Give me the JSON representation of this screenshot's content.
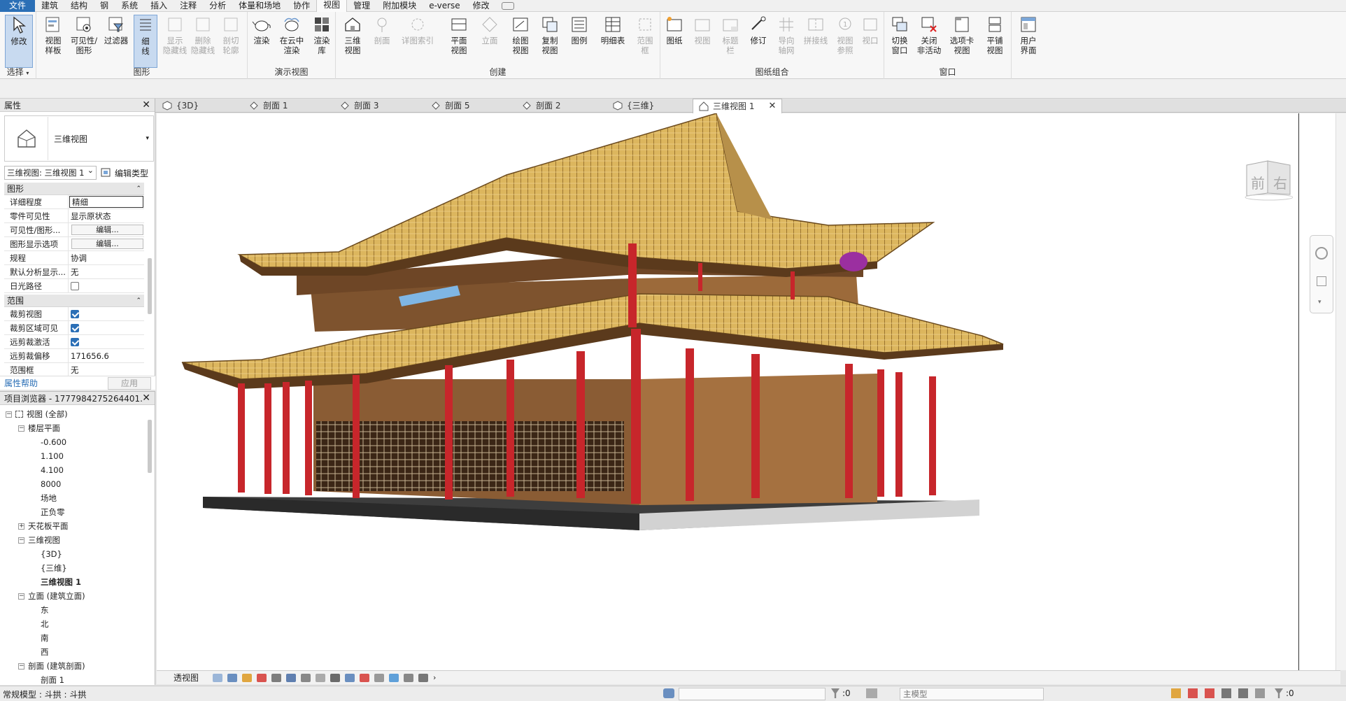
{
  "menu": {
    "tabs": [
      {
        "label": "文件",
        "name": "menu-tab-file"
      },
      {
        "label": "建筑",
        "name": "menu-tab-architecture"
      },
      {
        "label": "结构",
        "name": "menu-tab-structure"
      },
      {
        "label": "钢",
        "name": "menu-tab-steel"
      },
      {
        "label": "系统",
        "name": "menu-tab-systems"
      },
      {
        "label": "插入",
        "name": "menu-tab-insert"
      },
      {
        "label": "注释",
        "name": "menu-tab-annotate"
      },
      {
        "label": "分析",
        "name": "menu-tab-analyze"
      },
      {
        "label": "体量和场地",
        "name": "menu-tab-massing"
      },
      {
        "label": "协作",
        "name": "menu-tab-collaborate"
      },
      {
        "label": "视图",
        "name": "menu-tab-view"
      },
      {
        "label": "管理",
        "name": "menu-tab-manage"
      },
      {
        "label": "附加模块",
        "name": "menu-tab-addins"
      },
      {
        "label": "e-verse",
        "name": "menu-tab-everse"
      },
      {
        "label": "修改",
        "name": "menu-tab-modify"
      }
    ],
    "active": "视图"
  },
  "ribbon": {
    "groups": {
      "select": "选择",
      "graphics": "图形",
      "presentation": "演示视图",
      "create": "创建",
      "sheet": "图纸组合",
      "window": "窗口"
    },
    "buttons": {
      "modify": "修改",
      "view_template": "视图\n样板",
      "visibility": "可见性/\n图形",
      "filters": "过滤器",
      "thin_lines": "细\n线",
      "show_hidden": "显示\n隐藏线",
      "remove_hidden": "删除\n隐藏线",
      "cut_profile": "剖切\n轮廓",
      "render": "渲染",
      "render_cloud": "在云中\n渲染",
      "render_gallery": "渲染\n库",
      "three_d": "三维\n视图",
      "section": "剖面",
      "callout": "详图索引",
      "plan": "平面\n视图",
      "elevation": "立面",
      "drafting": "绘图\n视图",
      "duplicate": "复制\n视图",
      "legends": "图例",
      "schedules": "明细表",
      "scope_box": "范围\n框",
      "sheet": "图纸",
      "view": "视图",
      "title_block": "标题\n栏",
      "revisions": "修订",
      "guide_grid": "导向\n轴网",
      "matchline": "拼接线",
      "view_ref": "视图\n参照",
      "viewports": "视口",
      "switch_windows": "切换\n窗口",
      "close_inactive": "关闭\n非活动",
      "tab_views": "选项卡\n视图",
      "tile_views": "平铺\n视图",
      "user_interface": "用户\n界面"
    }
  },
  "properties": {
    "title": "属性",
    "type_name": "三维视图",
    "type_selector": "三维视图: 三维视图 1",
    "edit_type": "编辑类型",
    "sections": {
      "graphics": "图形",
      "extents": "范围"
    },
    "graphics_rows": [
      {
        "key": "详细程度",
        "value": "精细",
        "kind": "boxed"
      },
      {
        "key": "零件可见性",
        "value": "显示原状态",
        "kind": "text"
      },
      {
        "key": "可见性/图形...",
        "value": "编辑...",
        "kind": "button"
      },
      {
        "key": "图形显示选项",
        "value": "编辑...",
        "kind": "button"
      },
      {
        "key": "规程",
        "value": "协调",
        "kind": "text"
      },
      {
        "key": "默认分析显示...",
        "value": "无",
        "kind": "text"
      },
      {
        "key": "日光路径",
        "value": "",
        "kind": "check-off"
      }
    ],
    "extents_rows": [
      {
        "key": "裁剪视图",
        "value": "",
        "kind": "check-on"
      },
      {
        "key": "裁剪区域可见",
        "value": "",
        "kind": "check-on"
      },
      {
        "key": "远剪裁激活",
        "value": "",
        "kind": "check-on"
      },
      {
        "key": "远剪裁偏移",
        "value": "171656.6",
        "kind": "text"
      },
      {
        "key": "范围框",
        "value": "无",
        "kind": "text"
      }
    ],
    "help_link": "属性帮助",
    "apply": "应用"
  },
  "browser": {
    "title": "项目浏览器 - 1777984275264401...",
    "tree": [
      {
        "label": "视图 (全部)",
        "indent": 0,
        "toggle": "-",
        "icon": true
      },
      {
        "label": "楼层平面",
        "indent": 1,
        "toggle": "-"
      },
      {
        "label": "-0.600",
        "indent": 2
      },
      {
        "label": "1.100",
        "indent": 2
      },
      {
        "label": "4.100",
        "indent": 2
      },
      {
        "label": "8000",
        "indent": 2
      },
      {
        "label": "场地",
        "indent": 2
      },
      {
        "label": "正负零",
        "indent": 2
      },
      {
        "label": "天花板平面",
        "indent": 1,
        "toggle": "+"
      },
      {
        "label": "三维视图",
        "indent": 1,
        "toggle": "-"
      },
      {
        "label": "{3D}",
        "indent": 2
      },
      {
        "label": "{三维}",
        "indent": 2
      },
      {
        "label": "三维视图 1",
        "indent": 2,
        "bold": true
      },
      {
        "label": "立面 (建筑立面)",
        "indent": 1,
        "toggle": "-"
      },
      {
        "label": "东",
        "indent": 2
      },
      {
        "label": "北",
        "indent": 2
      },
      {
        "label": "南",
        "indent": 2
      },
      {
        "label": "西",
        "indent": 2
      },
      {
        "label": "剖面 (建筑剖面)",
        "indent": 1,
        "toggle": "-"
      },
      {
        "label": "剖面 1",
        "indent": 2
      }
    ]
  },
  "view_tabs": [
    {
      "label": "{3D}",
      "icon": "cube"
    },
    {
      "label": "剖面 1",
      "icon": "section"
    },
    {
      "label": "剖面 3",
      "icon": "section"
    },
    {
      "label": "剖面 5",
      "icon": "section"
    },
    {
      "label": "剖面 2",
      "icon": "section"
    },
    {
      "label": "{三维}",
      "icon": "cube"
    },
    {
      "label": "三维视图 1",
      "icon": "house",
      "active": true
    }
  ],
  "viewcube": {
    "front": "前",
    "right": "右"
  },
  "view_control": {
    "label": "透视图"
  },
  "status": {
    "message": "常规模型 : 斗拱 : 斗拱",
    "selection_count": ":0",
    "model": "主模型",
    "filter_count": ":0"
  },
  "colors": {
    "accent": "#2b6fb6",
    "roof": "#d9b45f",
    "wall": "#9a6a3a",
    "column": "#c8282d",
    "base": "#3a3a3a"
  }
}
